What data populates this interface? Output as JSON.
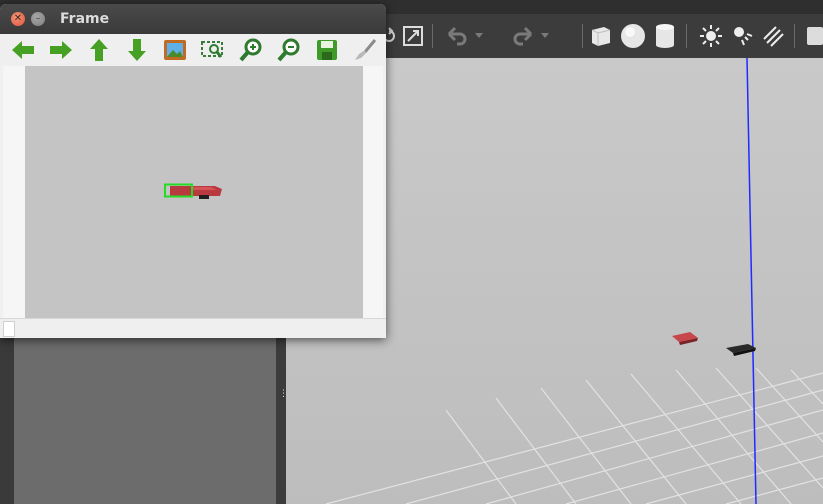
{
  "frame_window": {
    "title": "Frame",
    "toolbar": [
      {
        "name": "back",
        "icon": "arrow-left-icon"
      },
      {
        "name": "forward",
        "icon": "arrow-right-icon"
      },
      {
        "name": "up",
        "icon": "arrow-up-icon"
      },
      {
        "name": "down",
        "icon": "arrow-down-icon"
      },
      {
        "name": "home",
        "icon": "image-icon"
      },
      {
        "name": "zoom-to-rect",
        "icon": "zoom-rect-icon"
      },
      {
        "name": "zoom-in",
        "icon": "zoom-in-icon"
      },
      {
        "name": "zoom-out",
        "icon": "zoom-out-icon"
      },
      {
        "name": "save",
        "icon": "save-icon"
      },
      {
        "name": "customize",
        "icon": "brush-icon"
      }
    ],
    "status_text": ""
  },
  "gazebo": {
    "toolbar": [
      "select-icon",
      "translate-icon",
      "rotate-icon",
      "scale-icon",
      "undo-icon",
      "redo-icon",
      "box-icon",
      "sphere-icon",
      "cylinder-icon",
      "point-light-icon",
      "spot-light-icon",
      "directional-light-icon",
      "screenshot-icon"
    ]
  },
  "colors": {
    "titlebar": "#3f3f3f",
    "canvas_bg": "#c4c4c4",
    "detection_box": "#22dd22",
    "robot_red": "#b83a3e",
    "robot_black": "#1f1f1f",
    "viewport_bg": "#c4c4c4",
    "axis_blue": "#1f2bff",
    "grid_line": "#e2e2e2"
  }
}
